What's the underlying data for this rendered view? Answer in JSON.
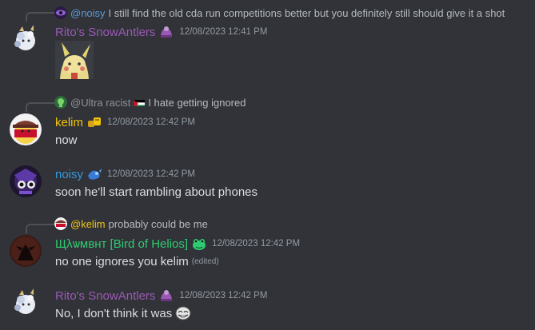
{
  "colors": {
    "background": "#313338",
    "rito": "#9b59b6",
    "kelim": "#f1c40f",
    "noisy": "#3498db",
    "shlomo": "#2ecc71",
    "timestamp": "#949ba4",
    "text": "#dbdee1"
  },
  "messages": [
    {
      "reply": {
        "name": "@noisy",
        "text": "I still find the old cda run competitions better but you definitely still should give it a shot"
      },
      "author": "Rito's SnowAntlers",
      "timestamp": "12/08/2023 12:41 PM",
      "content": "",
      "attachment": "pikachu-image"
    },
    {
      "reply": {
        "name": "@Ultra racist",
        "text": "I hate getting ignored"
      },
      "author": "kelim",
      "timestamp": "12/08/2023 12:42 PM",
      "content": "now"
    },
    {
      "author": "noisy",
      "timestamp": "12/08/2023 12:42 PM",
      "content": "soon he'll start rambling about phones"
    },
    {
      "reply": {
        "name": "@kelim",
        "text": "probably could be me"
      },
      "author": "Щλѡмвнт [Bird of Helios]",
      "timestamp": "12/08/2023 12:42 PM",
      "content": "no one ignores you kelim",
      "edited": "(edited)"
    },
    {
      "author": "Rito's SnowAntlers",
      "timestamp": "12/08/2023 12:42 PM",
      "content": "No, I don't think it was"
    }
  ]
}
